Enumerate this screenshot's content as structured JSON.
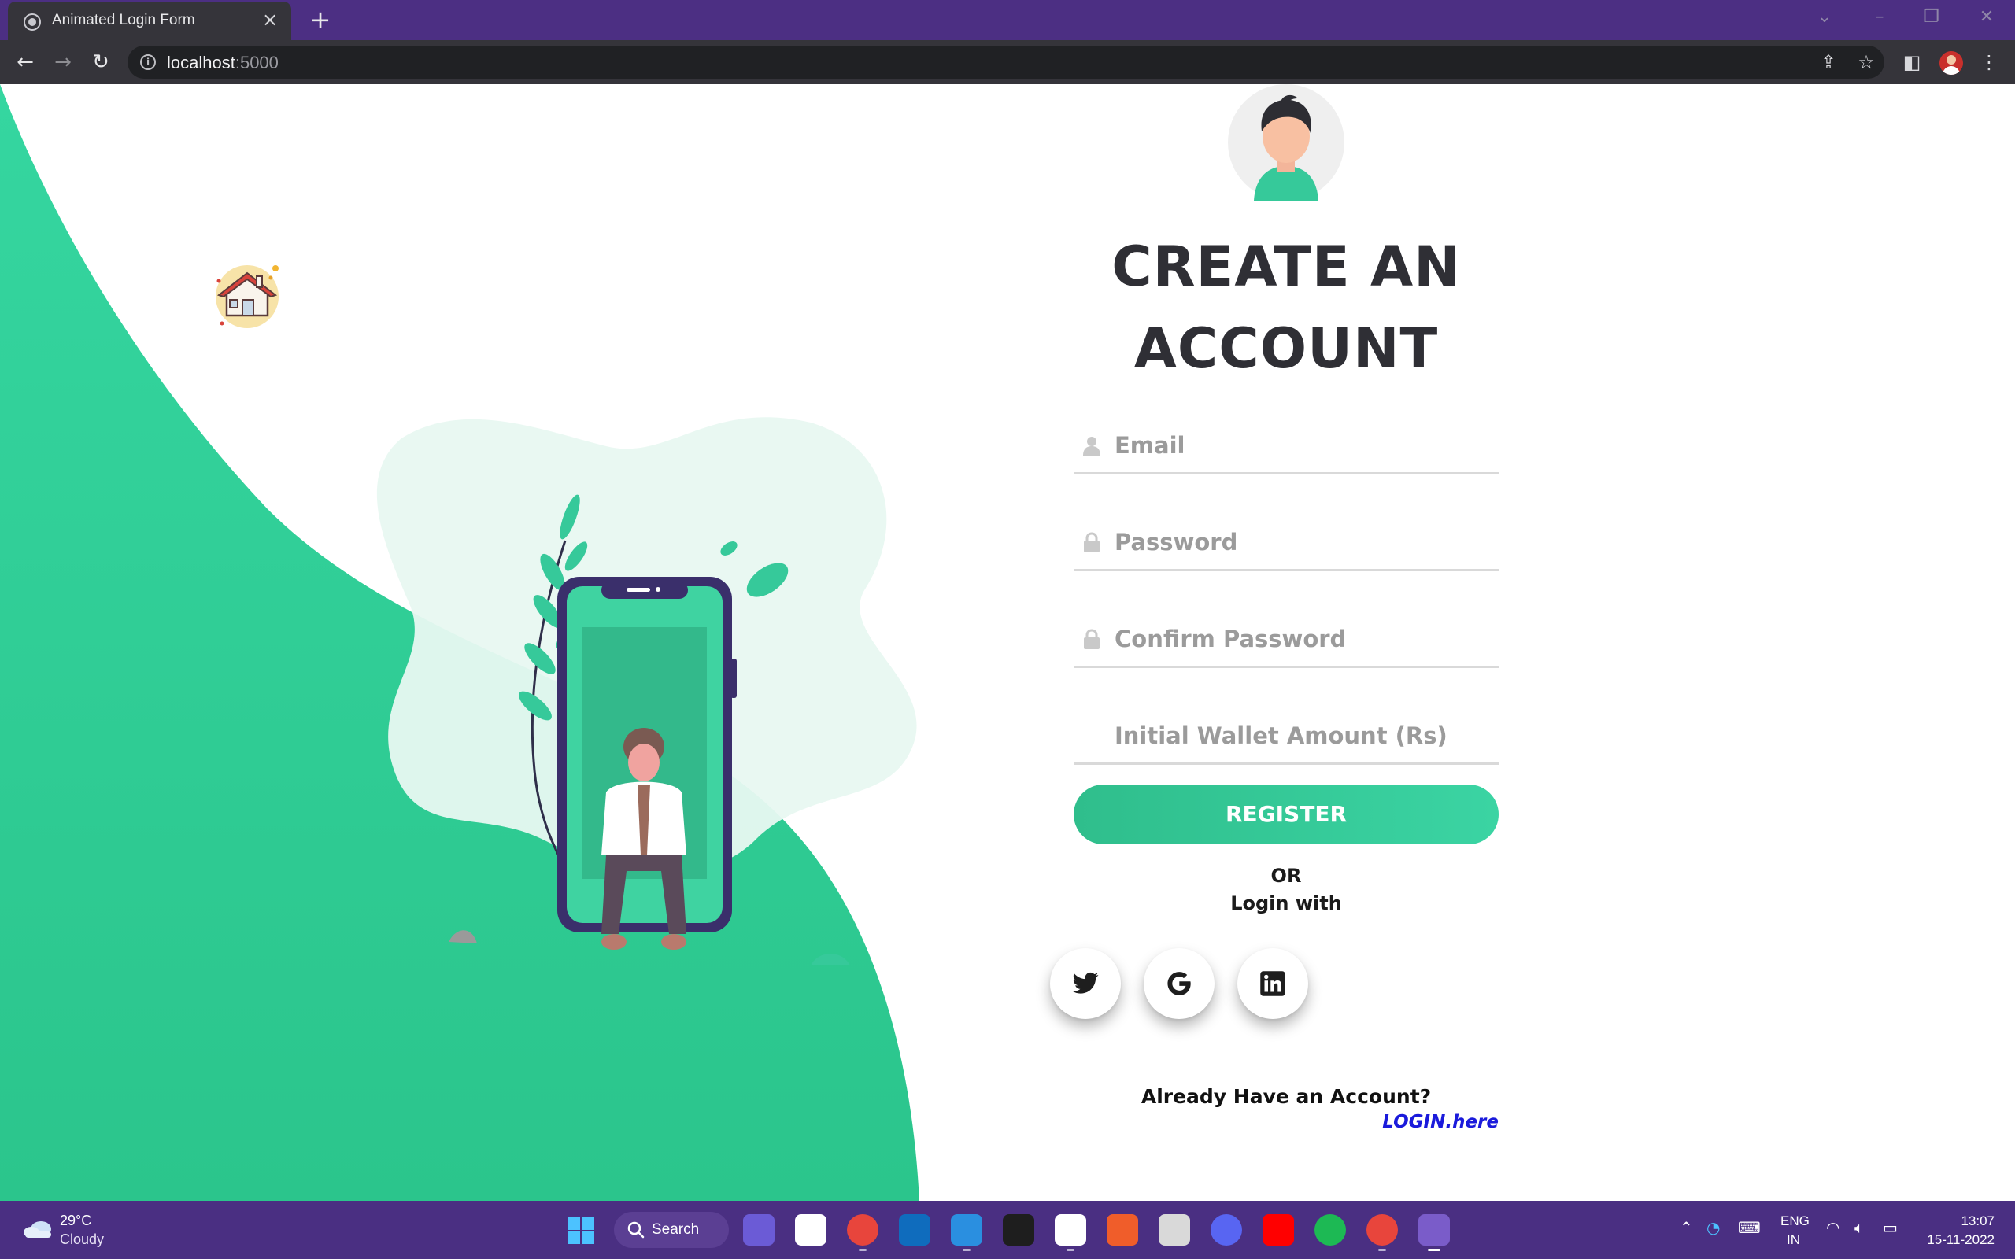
{
  "browser": {
    "tab_title": "Animated Login Form",
    "tab_close": "×",
    "new_tab": "+",
    "url_host": "localhost",
    "url_port": ":5000",
    "icons": [
      "back-arrow-icon",
      "forward-arrow-icon",
      "reload-icon",
      "info-icon",
      "share-icon",
      "star-icon",
      "side-panel-icon",
      "profile-avatar",
      "kebab-menu-icon"
    ]
  },
  "form": {
    "heading_line1": "CREATE AN",
    "heading_line2": "ACCOUNT",
    "email_placeholder": "Email",
    "password_placeholder": "Password",
    "confirm_placeholder": "Confirm Password",
    "wallet_placeholder": "Initial Wallet Amount (Rs)",
    "register_label": "REGISTER",
    "or_label": "OR",
    "login_with_label": "Login with",
    "social": [
      "twitter-icon",
      "google-icon",
      "linkedin-icon"
    ],
    "already_label": "Already Have an Account?",
    "login_link_label": "LOGIN.here"
  },
  "colors": {
    "brand_green": "#2ecf95",
    "heading": "#2f2f35",
    "link": "#1a1adb",
    "chrome_purple": "#4c2f83",
    "taskbar_purple": "#4a2f82"
  },
  "taskbar": {
    "temp": "29°C",
    "weather": "Cloudy",
    "search_label": "Search",
    "lang_line1": "ENG",
    "lang_line2": "IN",
    "time": "13:07",
    "date": "15-11-2022",
    "apps": [
      "teams-icon",
      "slack-icon",
      "chrome-icon",
      "outlook-icon",
      "vscode-icon",
      "figma-icon",
      "notion-icon",
      "brave-icon",
      "unity-icon",
      "discord-icon",
      "youtube-icon",
      "spotify-icon",
      "chrome-profile-icon",
      "snipping-tool-icon"
    ]
  }
}
